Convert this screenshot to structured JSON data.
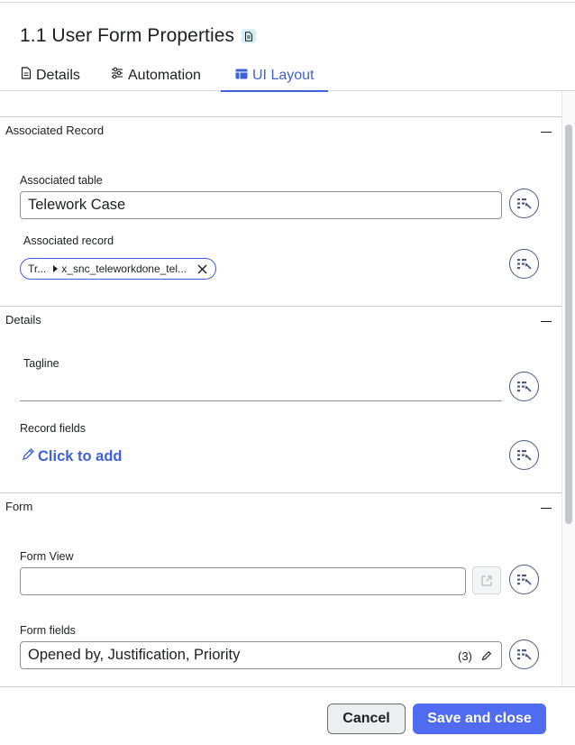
{
  "header": {
    "title": "1.1 User Form Properties"
  },
  "tabs": [
    {
      "label": "Details",
      "icon": "document-icon",
      "active": false
    },
    {
      "label": "Automation",
      "icon": "sliders-icon",
      "active": false
    },
    {
      "label": "UI Layout",
      "icon": "layout-icon",
      "active": true
    }
  ],
  "sections": {
    "associated_record": {
      "title": "Associated Record",
      "table_label": "Associated table",
      "table_value": "Telework Case",
      "record_label": "Associated record",
      "record_pill_prefix": "Tr...",
      "record_pill_value": "x_snc_teleworkdone_tel..."
    },
    "details": {
      "title": "Details",
      "tagline_label": "Tagline",
      "tagline_value": "",
      "record_fields_label": "Record fields",
      "click_to_add": "Click to add"
    },
    "form": {
      "title": "Form",
      "form_view_label": "Form View",
      "form_view_value": "",
      "form_fields_label": "Form fields",
      "form_fields_value": "Opened by, Justification, Priority",
      "form_fields_count": "(3)"
    }
  },
  "footer": {
    "cancel_label": "Cancel",
    "save_label": "Save and close"
  },
  "colors": {
    "accent": "#3d5fd9",
    "primary_button": "#4f6bef",
    "pill_border": "#3d5fd9"
  }
}
